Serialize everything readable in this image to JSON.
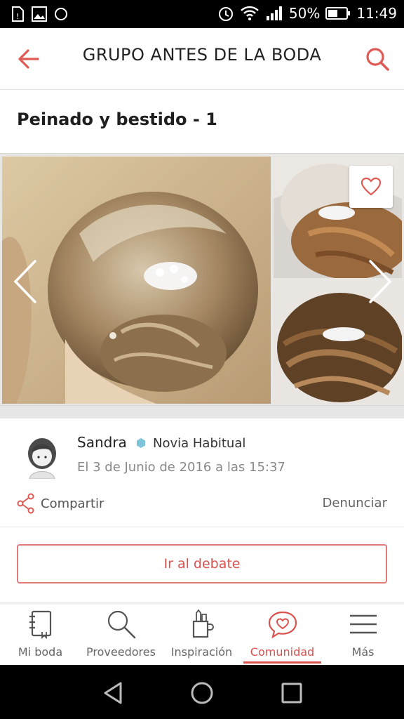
{
  "status_bar": {
    "battery": "50%",
    "time": "11:49",
    "icons": [
      "sim-alert-icon",
      "image-icon",
      "circle-icon",
      "alarm-icon",
      "wifi-icon",
      "signal-icon",
      "battery-icon"
    ]
  },
  "app_bar": {
    "title": "GRUPO ANTES DE LA BODA",
    "back_icon": "arrow-left-icon",
    "search_icon": "search-icon"
  },
  "post": {
    "title": "Peinado y bestido - 1"
  },
  "gallery": {
    "favorite_icon": "heart-icon",
    "prev_icon": "chevron-left-icon",
    "next_icon": "chevron-right-icon"
  },
  "author": {
    "name": "Sandra",
    "badge": "Novia Habitual",
    "date": "El 3 de Junio de 2016 a las 15:37"
  },
  "actions": {
    "share": "Compartir",
    "report": "Denunciar",
    "debate": "Ir al debate"
  },
  "tabs": [
    {
      "label": "Mi boda",
      "icon": "notebook-icon"
    },
    {
      "label": "Proveedores",
      "icon": "search-icon"
    },
    {
      "label": "Inspiración",
      "icon": "pencil-cup-icon"
    },
    {
      "label": "Comunidad",
      "icon": "chat-heart-icon",
      "active": true
    },
    {
      "label": "Más",
      "icon": "menu-icon"
    }
  ],
  "colors": {
    "accent": "#d9534f",
    "badge": "#7fc4d8"
  }
}
